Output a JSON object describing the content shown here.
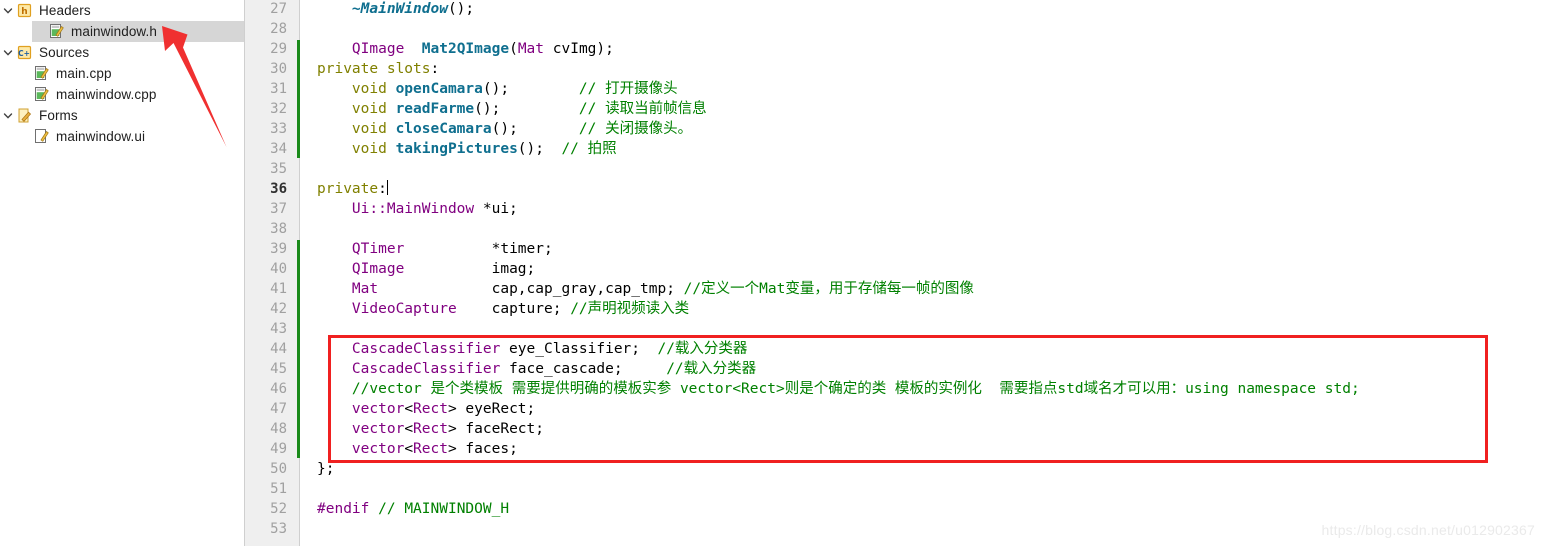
{
  "sidebar": {
    "items": [
      {
        "label": "Headers",
        "icon": "header-folder-icon",
        "depth": 0,
        "expanded": true,
        "selected": false,
        "chevron": "chevron-down-icon"
      },
      {
        "label": "mainwindow.h",
        "icon": "header-file-icon",
        "depth": 1,
        "expanded": null,
        "selected": true,
        "chevron": ""
      },
      {
        "label": "Sources",
        "icon": "sources-folder-icon",
        "depth": 0,
        "expanded": true,
        "selected": false,
        "chevron": "chevron-down-icon"
      },
      {
        "label": "main.cpp",
        "icon": "cpp-file-icon",
        "depth": 1,
        "expanded": null,
        "selected": false,
        "chevron": ""
      },
      {
        "label": "mainwindow.cpp",
        "icon": "cpp-file-icon",
        "depth": 1,
        "expanded": null,
        "selected": false,
        "chevron": ""
      },
      {
        "label": "Forms",
        "icon": "forms-folder-icon",
        "depth": 0,
        "expanded": true,
        "selected": false,
        "chevron": "chevron-down-icon"
      },
      {
        "label": "mainwindow.ui",
        "icon": "ui-file-icon",
        "depth": 1,
        "expanded": null,
        "selected": false,
        "chevron": ""
      }
    ]
  },
  "editor": {
    "first_line": 27,
    "last_line": 53,
    "current_line": 36,
    "change_bar_ranges": [
      [
        29,
        34
      ],
      [
        39,
        49
      ]
    ],
    "lines": [
      {
        "n": 27,
        "text": "    ~MainWindow();"
      },
      {
        "n": 28,
        "text": ""
      },
      {
        "n": 29,
        "text": "    QImage  Mat2QImage(Mat cvImg);"
      },
      {
        "n": 30,
        "text": "private slots:"
      },
      {
        "n": 31,
        "text": "    void openCamara();        // 打开摄像头"
      },
      {
        "n": 32,
        "text": "    void readFarme();         // 读取当前帧信息"
      },
      {
        "n": 33,
        "text": "    void closeCamara();       // 关闭摄像头。"
      },
      {
        "n": 34,
        "text": "    void takingPictures();  // 拍照"
      },
      {
        "n": 35,
        "text": ""
      },
      {
        "n": 36,
        "text": "private:"
      },
      {
        "n": 37,
        "text": "    Ui::MainWindow *ui;"
      },
      {
        "n": 38,
        "text": ""
      },
      {
        "n": 39,
        "text": "    QTimer          *timer;"
      },
      {
        "n": 40,
        "text": "    QImage          imag;"
      },
      {
        "n": 41,
        "text": "    Mat             cap,cap_gray,cap_tmp; //定义一个Mat变量，用于存储每一帧的图像"
      },
      {
        "n": 42,
        "text": "    VideoCapture    capture; //声明视频读入类"
      },
      {
        "n": 43,
        "text": ""
      },
      {
        "n": 44,
        "text": "    CascadeClassifier eye_Classifier;  //载入分类器"
      },
      {
        "n": 45,
        "text": "    CascadeClassifier face_cascade;     //载入分类器"
      },
      {
        "n": 46,
        "text": "    //vector 是个类模板 需要提供明确的模板实参 vector<Rect>则是个确定的类 模板的实例化  需要指点std域名才可以用：using namespace std;"
      },
      {
        "n": 47,
        "text": "    vector<Rect> eyeRect;"
      },
      {
        "n": 48,
        "text": "    vector<Rect> faceRect;"
      },
      {
        "n": 49,
        "text": "    vector<Rect> faces;"
      },
      {
        "n": 50,
        "text": "};"
      },
      {
        "n": 51,
        "text": ""
      },
      {
        "n": 52,
        "text": "#endif // MAINWINDOW_H"
      },
      {
        "n": 53,
        "text": ""
      }
    ],
    "tokens": {
      "l27": [
        [
          "pl",
          "    "
        ],
        [
          "fni",
          "~MainWindow"
        ],
        [
          "pl",
          "();"
        ]
      ],
      "l29": [
        [
          "pl",
          "    "
        ],
        [
          "typ",
          "QImage"
        ],
        [
          "pl",
          "  "
        ],
        [
          "fn",
          "Mat2QImage"
        ],
        [
          "pl",
          "("
        ],
        [
          "typ",
          "Mat"
        ],
        [
          "pl",
          " cvImg);"
        ]
      ],
      "l30": [
        [
          "k",
          "private slots"
        ],
        [
          "pl",
          ":"
        ]
      ],
      "l31": [
        [
          "pl",
          "    "
        ],
        [
          "k",
          "void"
        ],
        [
          "pl",
          " "
        ],
        [
          "fn",
          "openCamara"
        ],
        [
          "pl",
          "();        "
        ],
        [
          "cm",
          "// 打开摄像头"
        ]
      ],
      "l32": [
        [
          "pl",
          "    "
        ],
        [
          "k",
          "void"
        ],
        [
          "pl",
          " "
        ],
        [
          "fn",
          "readFarme"
        ],
        [
          "pl",
          "();         "
        ],
        [
          "cm",
          "// 读取当前帧信息"
        ]
      ],
      "l33": [
        [
          "pl",
          "    "
        ],
        [
          "k",
          "void"
        ],
        [
          "pl",
          " "
        ],
        [
          "fn",
          "closeCamara"
        ],
        [
          "pl",
          "();       "
        ],
        [
          "cm",
          "// 关闭摄像头。"
        ]
      ],
      "l34": [
        [
          "pl",
          "    "
        ],
        [
          "k",
          "void"
        ],
        [
          "pl",
          " "
        ],
        [
          "fn",
          "takingPictures"
        ],
        [
          "pl",
          "();  "
        ],
        [
          "cm",
          "// 拍照"
        ]
      ],
      "l36": [
        [
          "k",
          "private"
        ],
        [
          "pl",
          ":"
        ]
      ],
      "l37": [
        [
          "pl",
          "    "
        ],
        [
          "typ",
          "Ui::MainWindow"
        ],
        [
          "pl",
          " *ui;"
        ]
      ],
      "l39": [
        [
          "pl",
          "    "
        ],
        [
          "typ",
          "QTimer"
        ],
        [
          "pl",
          "          *timer;"
        ]
      ],
      "l40": [
        [
          "pl",
          "    "
        ],
        [
          "typ",
          "QImage"
        ],
        [
          "pl",
          "          imag;"
        ]
      ],
      "l41": [
        [
          "pl",
          "    "
        ],
        [
          "typ",
          "Mat"
        ],
        [
          "pl",
          "             cap,cap_gray,cap_tmp; "
        ],
        [
          "cm",
          "//定义一个Mat变量，用于存储每一帧的图像"
        ]
      ],
      "l42": [
        [
          "pl",
          "    "
        ],
        [
          "typ",
          "VideoCapture"
        ],
        [
          "pl",
          "    capture; "
        ],
        [
          "cm",
          "//声明视频读入类"
        ]
      ],
      "l44": [
        [
          "pl",
          "    "
        ],
        [
          "typ",
          "CascadeClassifier"
        ],
        [
          "pl",
          " eye_Classifier;  "
        ],
        [
          "cm",
          "//载入分类器"
        ]
      ],
      "l45": [
        [
          "pl",
          "    "
        ],
        [
          "typ",
          "CascadeClassifier"
        ],
        [
          "pl",
          " face_cascade;     "
        ],
        [
          "cm",
          "//载入分类器"
        ]
      ],
      "l46": [
        [
          "pl",
          "    "
        ],
        [
          "cm",
          "//vector 是个类模板 需要提供明确的模板实参 vector<Rect>则是个确定的类 模板的实例化  需要指点std域名才可以用：using namespace std;"
        ]
      ],
      "l47": [
        [
          "pl",
          "    "
        ],
        [
          "typ",
          "vector"
        ],
        [
          "pl",
          "<"
        ],
        [
          "typ",
          "Rect"
        ],
        [
          "pl",
          "> eyeRect;"
        ]
      ],
      "l48": [
        [
          "pl",
          "    "
        ],
        [
          "typ",
          "vector"
        ],
        [
          "pl",
          "<"
        ],
        [
          "typ",
          "Rect"
        ],
        [
          "pl",
          "> faceRect;"
        ]
      ],
      "l49": [
        [
          "pl",
          "    "
        ],
        [
          "typ",
          "vector"
        ],
        [
          "pl",
          "<"
        ],
        [
          "typ",
          "Rect"
        ],
        [
          "pl",
          "> faces;"
        ]
      ],
      "l50": [
        [
          "pl",
          "};"
        ]
      ],
      "l52": [
        [
          "pp",
          "#endif"
        ],
        [
          "pl",
          " "
        ],
        [
          "cm",
          "// MAINWINDOW_H"
        ]
      ]
    }
  },
  "annotations": {
    "highlight_box_color": "#f02020",
    "arrow_color": "#f03030",
    "watermark": "https://blog.csdn.net/u012902367"
  },
  "colors": {
    "keyword": "#808000",
    "type": "#800080",
    "function": "#0f6f8f",
    "comment": "#008000",
    "gutter_bg": "#efefef",
    "changebar": "#1a8a1a",
    "selection_bg": "#d6d6d6"
  }
}
